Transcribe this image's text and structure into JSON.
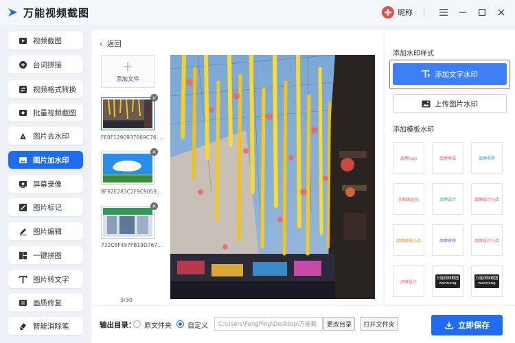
{
  "app": {
    "title": "万能视频截图",
    "user_nickname": "昵称"
  },
  "sidebar": {
    "items": [
      {
        "label": "视频截图",
        "icon": "video-capture-icon",
        "active": false
      },
      {
        "label": "台词拼接",
        "icon": "subtitle-stitch-icon",
        "active": false
      },
      {
        "label": "视频格式转换",
        "icon": "video-convert-icon",
        "active": false
      },
      {
        "label": "批量视频截图",
        "icon": "batch-capture-icon",
        "active": false
      },
      {
        "label": "图片去水印",
        "icon": "remove-watermark-icon",
        "active": false
      },
      {
        "label": "图片加水印",
        "icon": "add-watermark-icon",
        "active": true
      },
      {
        "label": "屏幕录像",
        "icon": "screen-record-icon",
        "active": false
      },
      {
        "label": "图片标记",
        "icon": "image-mark-icon",
        "active": false
      },
      {
        "label": "图片编辑",
        "icon": "image-edit-icon",
        "active": false
      },
      {
        "label": "一键拼图",
        "icon": "collage-icon",
        "active": false
      },
      {
        "label": "图片转文字",
        "icon": "image-to-text-icon",
        "active": false
      },
      {
        "label": "画质修复",
        "icon": "quality-repair-icon",
        "active": false
      },
      {
        "label": "智能消除笔",
        "icon": "smart-eraser-icon",
        "active": false
      }
    ]
  },
  "main": {
    "back_label": "返回",
    "add_file_label": "添加文件",
    "files": [
      {
        "name": "FE0F1290937669C76...",
        "selected": true
      },
      {
        "name": "8F92E283C2F9C9059...",
        "selected": false
      },
      {
        "name": "732C8F497FB19D767...",
        "selected": false
      }
    ],
    "pager": "3/30"
  },
  "right": {
    "style_title": "添加水印样式",
    "add_text_label": "添加文字水印",
    "upload_image_label": "上传图片水印",
    "template_title": "添加模板水印",
    "templates": [
      {
        "text": "品牌logo",
        "color": "#e05a5a"
      },
      {
        "text": "品牌承诺",
        "color": "#e0556b"
      },
      {
        "text": "品牌名称",
        "color": "#2e8fd8"
      },
      {
        "text": "实拍图必究",
        "color": "#d85a3a"
      },
      {
        "text": "品牌设计",
        "color": "#3aa05a"
      },
      {
        "text": "品牌设计小店",
        "color": "#d8405a"
      },
      {
        "text": "品牌旗舰小店",
        "color": "#e88a20"
      },
      {
        "text": "品牌名称",
        "color": "#6a4ab8"
      },
      {
        "text": "品牌设计小店",
        "color": "#d84a8a"
      },
      {
        "text": "品牌设计",
        "color": "#e05a5a"
      },
      {
        "text": "万能视频截图",
        "text2": "wanneng",
        "black": true
      },
      {
        "text": "万能视频截图",
        "text2": "wanneng",
        "black": true
      }
    ]
  },
  "bottom": {
    "output_label": "输出目录：",
    "option_original": "原文件夹",
    "option_custom": "自定义",
    "path_value": "C:\\Users\\FengPing\\Desktop\\万能截",
    "change_dir_label": "更改目录",
    "open_folder_label": "打开文件夹",
    "save_label": "立即保存"
  }
}
